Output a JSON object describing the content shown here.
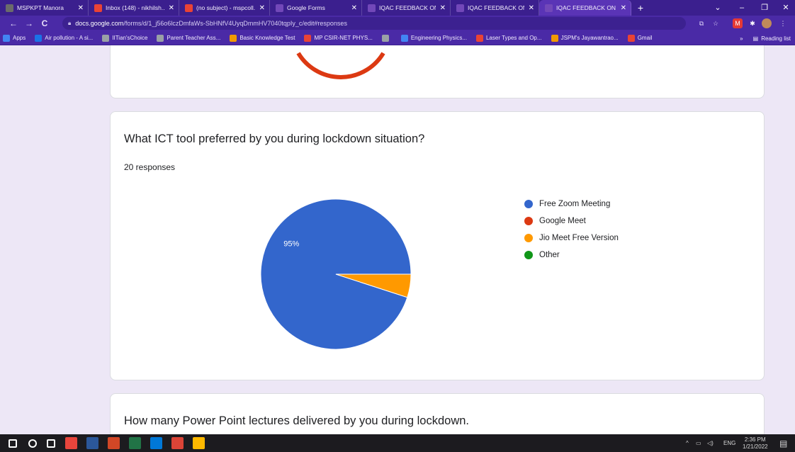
{
  "browser": {
    "tabs": [
      {
        "title": "MSPKPT Manora",
        "favicon_color": "#6b6b6b",
        "active": false
      },
      {
        "title": "Inbox (148) - nikhilsh...",
        "favicon_color": "#ea4335",
        "active": false
      },
      {
        "title": "(no subject) - mspcoll...",
        "favicon_color": "#ea4335",
        "active": false
      },
      {
        "title": "Google Forms",
        "favicon_color": "#7248b9",
        "active": false
      },
      {
        "title": "IQAC FEEDBACK ON IC",
        "favicon_color": "#7248b9",
        "active": false
      },
      {
        "title": "IQAC FEEDBACK ON IC",
        "favicon_color": "#7248b9",
        "active": false
      },
      {
        "title": "IQAC FEEDBACK ON IC",
        "favicon_color": "#7248b9",
        "active": true
      }
    ],
    "new_tab_label": "+",
    "window_controls": {
      "minimize": "–",
      "maximize": "❐",
      "close": "✕",
      "dropdown": "⌄"
    },
    "url_host": "docs.google.com",
    "url_path": "/forms/d/1_j56o6lczDmfaWs-SbHNfV4UyqDmmHV7040tqpIy_c/edit#responses",
    "nav": {
      "back": "←",
      "forward": "→",
      "reload": "C"
    },
    "bookmarks": [
      {
        "label": "Apps",
        "color": "#4285f4"
      },
      {
        "label": "Air pollution - A si...",
        "color": "#1a73e8"
      },
      {
        "label": "IITian'sChoice",
        "color": "#9aa0a6"
      },
      {
        "label": "Parent Teacher Ass...",
        "color": "#9aa0a6"
      },
      {
        "label": "Basic Knowledge Test",
        "color": "#f29900"
      },
      {
        "label": "MP CSIR-NET PHYS...",
        "color": "#ea4335"
      },
      {
        "label": "",
        "color": "#9aa0a6"
      },
      {
        "label": "Engineering Physics...",
        "color": "#4285f4"
      },
      {
        "label": "Laser Types and Op...",
        "color": "#ea4335"
      },
      {
        "label": "JSPM's Jayawantrao...",
        "color": "#f29900"
      },
      {
        "label": "Gmail",
        "color": "#ea4335"
      }
    ],
    "reading_list": "Reading list",
    "more_bookmarks": "»"
  },
  "form": {
    "question_1": {
      "title": "What ICT tool preferred by you during lockdown situation?",
      "responses": "20 responses",
      "slice_label": "95%"
    },
    "question_2": {
      "title": "How many Power Point lectures delivered by you during lockdown."
    }
  },
  "chart_data": {
    "type": "pie",
    "categories": [
      "Free Zoom Meeting",
      "Google Meet",
      "Jio Meet Free Version",
      "Other"
    ],
    "values": [
      95,
      0,
      5,
      0
    ],
    "colors": [
      "#3366cc",
      "#dc3912",
      "#ff9900",
      "#109618"
    ],
    "data_labels": [
      "95%",
      "",
      "",
      ""
    ],
    "legend_position": "right"
  },
  "taskbar": {
    "icons": [
      {
        "name": "start-icon",
        "color": "#ffffff"
      },
      {
        "name": "search-icon",
        "color": "#ffffff"
      },
      {
        "name": "task-view-icon",
        "color": "#ffffff"
      },
      {
        "name": "app-icon-1",
        "color": "#e8453c"
      },
      {
        "name": "word-icon",
        "color": "#2b579a"
      },
      {
        "name": "powerpoint-icon",
        "color": "#d24726"
      },
      {
        "name": "excel-icon",
        "color": "#217346"
      },
      {
        "name": "app-icon-2",
        "color": "#0078d7"
      },
      {
        "name": "chrome-icon",
        "color": "#db4437"
      },
      {
        "name": "files-icon",
        "color": "#ffb900"
      }
    ],
    "tray": {
      "chevron": "^",
      "language": "ENG",
      "time": "2:36 PM",
      "date": "1/21/2022"
    }
  }
}
